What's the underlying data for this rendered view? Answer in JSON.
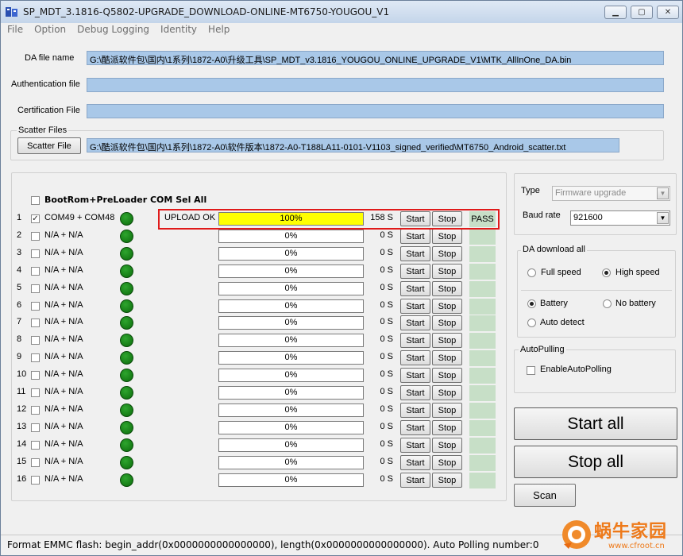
{
  "window": {
    "title": "SP_MDT_3.1816-Q5802-UPGRADE_DOWNLOAD-ONLINE-MT6750-YOUGOU_V1",
    "controls": [
      "minimize",
      "maximize",
      "close"
    ]
  },
  "menu": [
    "File",
    "Option",
    "Debug Logging",
    "Identity",
    "Help"
  ],
  "files": {
    "da_label": "DA file name",
    "da_value": "G:\\酷派软件包\\国内\\1系列\\1872-A0\\升级工具\\SP_MDT_v3.1816_YOUGOU_ONLINE_UPGRADE_V1\\MTK_AllInOne_DA.bin",
    "auth_label": "Authentication file",
    "auth_value": "",
    "cert_label": "Certification File",
    "cert_value": "",
    "scatter_group": "Scatter Files",
    "scatter_button": "Scatter File",
    "scatter_value": "G:\\酷派软件包\\国内\\1系列\\1872-A0\\软件版本\\1872-A0-T188LA11-0101-V1103_signed_verified\\MT6750_Android_scatter.txt"
  },
  "ports": {
    "sel_all_label": "BootRom+PreLoader COM Sel All",
    "start_label": "Start",
    "stop_label": "Stop",
    "rows": [
      {
        "num": "1",
        "checked": true,
        "com": "COM49 + COM48",
        "status": "UPLOAD OK",
        "progress": 1.0,
        "pct": "100%",
        "time": "158 S",
        "result": "PASS"
      },
      {
        "num": "2",
        "checked": false,
        "com": "N/A + N/A",
        "status": "",
        "progress": 0,
        "pct": "0%",
        "time": "0 S",
        "result": ""
      },
      {
        "num": "3",
        "checked": false,
        "com": "N/A + N/A",
        "status": "",
        "progress": 0,
        "pct": "0%",
        "time": "0 S",
        "result": ""
      },
      {
        "num": "4",
        "checked": false,
        "com": "N/A + N/A",
        "status": "",
        "progress": 0,
        "pct": "0%",
        "time": "0 S",
        "result": ""
      },
      {
        "num": "5",
        "checked": false,
        "com": "N/A + N/A",
        "status": "",
        "progress": 0,
        "pct": "0%",
        "time": "0 S",
        "result": ""
      },
      {
        "num": "6",
        "checked": false,
        "com": "N/A + N/A",
        "status": "",
        "progress": 0,
        "pct": "0%",
        "time": "0 S",
        "result": ""
      },
      {
        "num": "7",
        "checked": false,
        "com": "N/A + N/A",
        "status": "",
        "progress": 0,
        "pct": "0%",
        "time": "0 S",
        "result": ""
      },
      {
        "num": "8",
        "checked": false,
        "com": "N/A + N/A",
        "status": "",
        "progress": 0,
        "pct": "0%",
        "time": "0 S",
        "result": ""
      },
      {
        "num": "9",
        "checked": false,
        "com": "N/A + N/A",
        "status": "",
        "progress": 0,
        "pct": "0%",
        "time": "0 S",
        "result": ""
      },
      {
        "num": "10",
        "checked": false,
        "com": "N/A + N/A",
        "status": "",
        "progress": 0,
        "pct": "0%",
        "time": "0 S",
        "result": ""
      },
      {
        "num": "11",
        "checked": false,
        "com": "N/A + N/A",
        "status": "",
        "progress": 0,
        "pct": "0%",
        "time": "0 S",
        "result": ""
      },
      {
        "num": "12",
        "checked": false,
        "com": "N/A + N/A",
        "status": "",
        "progress": 0,
        "pct": "0%",
        "time": "0 S",
        "result": ""
      },
      {
        "num": "13",
        "checked": false,
        "com": "N/A + N/A",
        "status": "",
        "progress": 0,
        "pct": "0%",
        "time": "0 S",
        "result": ""
      },
      {
        "num": "14",
        "checked": false,
        "com": "N/A + N/A",
        "status": "",
        "progress": 0,
        "pct": "0%",
        "time": "0 S",
        "result": ""
      },
      {
        "num": "15",
        "checked": false,
        "com": "N/A + N/A",
        "status": "",
        "progress": 0,
        "pct": "0%",
        "time": "0 S",
        "result": ""
      },
      {
        "num": "16",
        "checked": false,
        "com": "N/A + N/A",
        "status": "",
        "progress": 0,
        "pct": "0%",
        "time": "0 S",
        "result": ""
      }
    ]
  },
  "right": {
    "type_label": "Type",
    "type_value": "Firmware upgrade",
    "baud_label": "Baud rate",
    "baud_value": "921600",
    "da_group": "DA download all",
    "full_speed": "Full speed",
    "high_speed": "High speed",
    "battery": "Battery",
    "no_battery": "No battery",
    "auto_detect": "Auto detect",
    "autopoll_group": "AutoPulling",
    "enable_autopoll": "EnableAutoPolling",
    "start_all": "Start all",
    "stop_all": "Stop all",
    "scan": "Scan"
  },
  "statusbar": {
    "text": "Format EMMC flash:  begin_addr(0x0000000000000000), length(0x0000000000000000). Auto Polling number:0"
  },
  "watermark": {
    "text": "蜗牛家园",
    "url": "www.cfroot.cn"
  },
  "colors": {
    "path_bg": "#a9c8e8",
    "progress_fill": "#ffff00",
    "led_green": "#1a8a1a",
    "pass_bg": "#c7dfc7",
    "highlight_border": "#e01a1a",
    "watermark_orange": "#ee7a1a"
  }
}
